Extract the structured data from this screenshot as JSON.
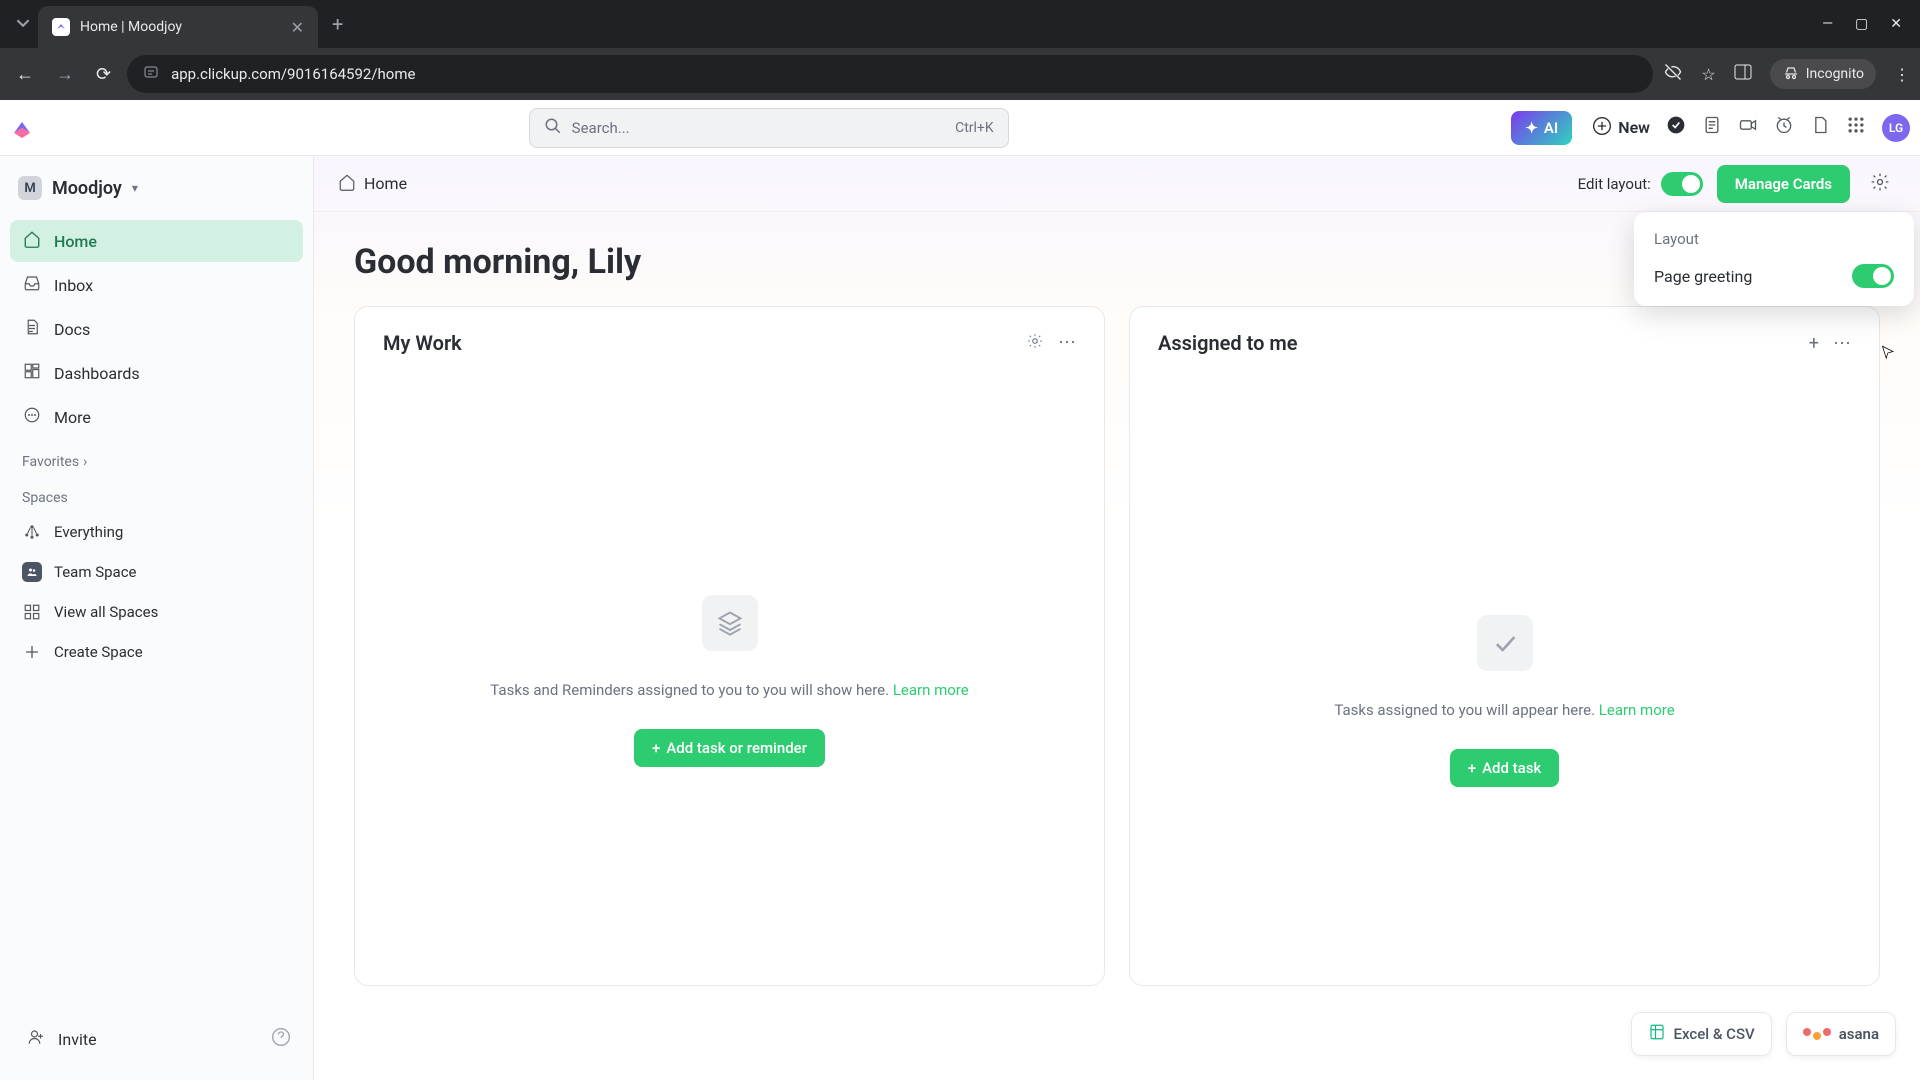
{
  "browser": {
    "tab_title": "Home | Moodjoy",
    "url": "app.clickup.com/9016164592/home",
    "incognito_label": "Incognito"
  },
  "topbar": {
    "search_placeholder": "Search...",
    "search_shortcut": "Ctrl+K",
    "ai_label": "AI",
    "new_label": "New",
    "avatar_initials": "LG"
  },
  "sidebar": {
    "workspace_initial": "M",
    "workspace_name": "Moodjoy",
    "nav": [
      {
        "label": "Home",
        "icon": "home"
      },
      {
        "label": "Inbox",
        "icon": "inbox"
      },
      {
        "label": "Docs",
        "icon": "doc"
      },
      {
        "label": "Dashboards",
        "icon": "dashboard"
      },
      {
        "label": "More",
        "icon": "more"
      }
    ],
    "favorites_label": "Favorites",
    "spaces_label": "Spaces",
    "spaces": [
      {
        "label": "Everything",
        "kind": "everything"
      },
      {
        "label": "Team Space",
        "kind": "team"
      },
      {
        "label": "View all Spaces",
        "kind": "viewall"
      },
      {
        "label": "Create Space",
        "kind": "create"
      }
    ],
    "invite_label": "Invite"
  },
  "main": {
    "breadcrumb": "Home",
    "edit_layout_label": "Edit layout:",
    "manage_cards_label": "Manage Cards",
    "greeting": "Good morning, Lily",
    "cards": {
      "my_work": {
        "title": "My Work",
        "empty_text": "Tasks and Reminders assigned to you to you will show here.",
        "learn_more": "Learn more",
        "button": "Add task or reminder"
      },
      "assigned": {
        "title": "Assigned to me",
        "empty_text": "Tasks assigned to you will appear here.",
        "learn_more": "Learn more",
        "button": "Add task"
      }
    },
    "popover": {
      "title": "Layout",
      "option": "Page greeting"
    },
    "float": {
      "excel": "Excel & CSV",
      "asana": "asana"
    }
  }
}
